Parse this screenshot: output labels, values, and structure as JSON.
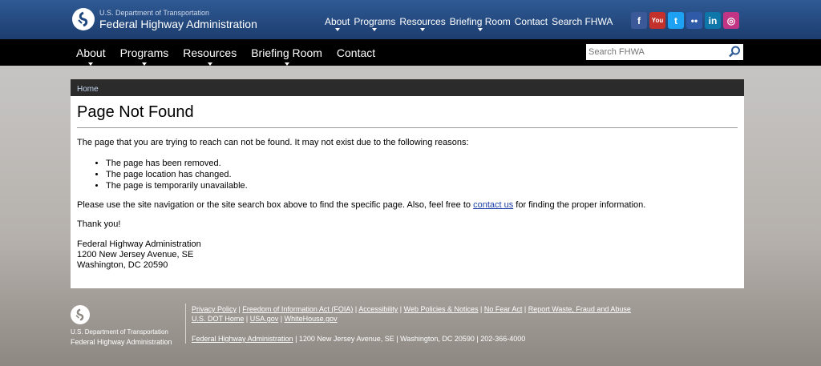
{
  "header": {
    "dept": "U.S. Department of Transportation",
    "agency": "Federal Highway Administration",
    "topnav": [
      "About",
      "Programs",
      "Resources",
      "Briefing Room",
      "Contact",
      "Search FHWA"
    ],
    "social": [
      {
        "name": "facebook-icon",
        "glyph": "f",
        "color": "#3b5998"
      },
      {
        "name": "youtube-icon",
        "glyph": "You",
        "color": "#c4302b"
      },
      {
        "name": "twitter-icon",
        "glyph": "t",
        "color": "#1da1f2"
      },
      {
        "name": "flickr-icon",
        "glyph": "••",
        "color": "#2f5aa8"
      },
      {
        "name": "linkedin-icon",
        "glyph": "in",
        "color": "#0e76a8"
      },
      {
        "name": "instagram-icon",
        "glyph": "◎",
        "color": "#c13584"
      }
    ]
  },
  "mainnav": {
    "items": [
      "About",
      "Programs",
      "Resources",
      "Briefing Room",
      "Contact"
    ],
    "search_placeholder": "Search FHWA"
  },
  "breadcrumb": {
    "home": "Home"
  },
  "page": {
    "title": "Page Not Found",
    "intro": "The page that you are trying to reach can not be found. It may not exist due to the following reasons:",
    "reasons": [
      "The page has been removed.",
      "The page location has changed.",
      "The page is temporarily unavailable."
    ],
    "advice_before": "Please use the site navigation or the site search box above to find the specific page. Also, feel free to ",
    "advice_link": "contact us",
    "advice_after": " for finding the proper information.",
    "thanks": "Thank you!",
    "address": [
      "Federal Highway Administration",
      "1200 New Jersey Avenue, SE",
      "Washington, DC 20590"
    ]
  },
  "footer": {
    "dept": "U.S. Department of Transportation",
    "agency": "Federal Highway Administration",
    "links_row1": [
      "Privacy Policy",
      "Freedom of Information Act (FOIA)",
      "Accessibility",
      "Web Policies & Notices",
      "No Fear Act",
      "Report Waste, Fraud and Abuse"
    ],
    "links_row2": [
      "U.S. DOT Home",
      "USA.gov",
      "WhiteHouse.gov"
    ],
    "address_link": "Federal Highway Administration",
    "address_rest": " | 1200 New Jersey Avenue, SE | Washington, DC 20590 | 202-366-4000"
  }
}
